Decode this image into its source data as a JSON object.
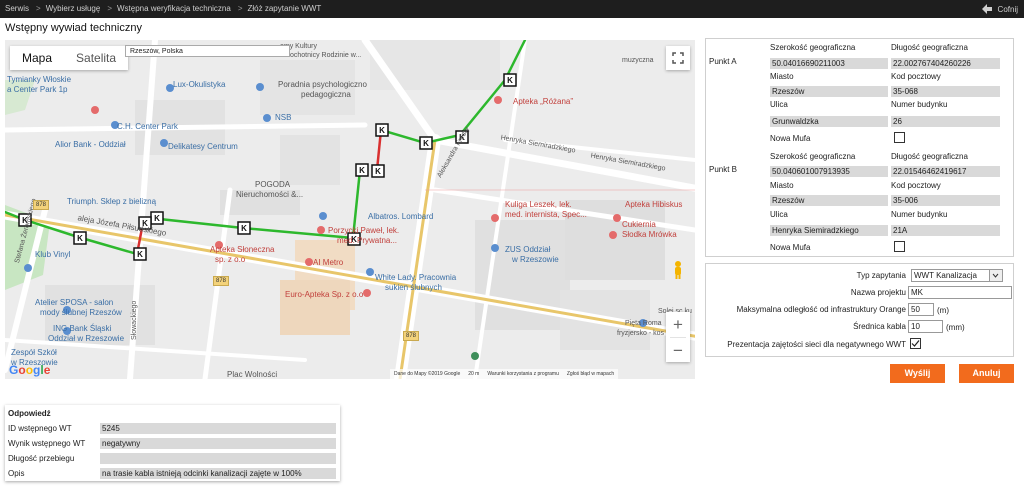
{
  "breadcrumb": [
    "Serwis",
    "Wybierz usługę",
    "Wstępna weryfikacja techniczna",
    "Złóż zapytanie WWT"
  ],
  "back_label": "Cofnij",
  "page_title": "Wstępny wywiad techniczny",
  "map": {
    "tab_map": "Mapa",
    "tab_satellite": "Satelita",
    "search_value": "Rzeszów, Polska",
    "attribution": "Dane do Mapy ©2019 Google",
    "scale": "20 m",
    "terms": "Warunki korzystania z programu",
    "report": "Zgłoś błąd w mapach",
    "google_logo": "Google",
    "cable_marker": "K",
    "labels": {
      "tymianki": "Tymianky Włoskie",
      "center_park_1p": "a Center Park 1p",
      "lux_okulistyka": "Lux-Okulistyka",
      "poradnia": "Poradnia psychologiczno",
      "pedagogiczna": "pedagogiczna",
      "centrum_kultury": "centrum Kultury",
      "domy_kultury": "omy Kultury",
      "ochotnicy": "ochotnicy Rodzinie w...",
      "muzyczna": "muzyczna",
      "ch_center_park": "C.H. Center Park",
      "nsb": "NSB",
      "alior": "Alior Bank - Oddział",
      "delikatesy": "Delikatesy Centrum",
      "apteka_rozana": "Apteka „Różana”",
      "triumph": "Triumph. Sklep z bielizną",
      "pogoda": "POGODA",
      "nieruchomosci": "Nieruchomości &...",
      "henryka1": "Henryka Siemiradzkiego",
      "henryka2": "Henryka Siemiradzkiego",
      "aleksandra": "Aleksandra Fredry",
      "albatros": "Albatros. Lombard",
      "porzycki": "Porzycki Paweł, lek.",
      "porzycki2": "med. Prywatna...",
      "kuliga": "Kuliga Leszek, lek.",
      "kuliga2": "med. internista, Spec...",
      "apteka_hibiskus": "Apteka Hibiskus",
      "cukiernia": "Cukiernia",
      "slodka": "Słodka Mrówka",
      "apteka_sloneczna": "Apteka Słoneczna",
      "apteka_sloneczna2": "sp. z o.o",
      "zus": "ZUS Oddział",
      "zus2": "w Rzeszowie",
      "ai_metro": "AI Metro",
      "white_lady": "White Lady. Pracownia",
      "white_lady2": "sukien ślubnych",
      "euro_apteka": "Euro-Apteka Sp. z o.o",
      "klub_vinyl": "Klub Vinyl",
      "aleja": "aleja Józefa Piłsudskiego",
      "atelier": "Atelier SPOSA - salon",
      "atelier2": "mody ślubnej Rzeszów",
      "ing": "ING Bank Śląski",
      "ing2": "Oddział w Rzeszowie",
      "zespol": "Zespół Szkół",
      "zespol2": "w Rzeszowie",
      "plac": "Plac Wolności",
      "solej": "Solej sc ku",
      "pieta": "Pięta Roma",
      "pieta2": "fryzjersko - kos",
      "stefana": "Stefana Żeromskiego",
      "jana": "Jana Kilińskiego",
      "kolowa": "Słowackiego",
      "plac_wol": "Plac Wolności",
      "rzeszow_p": "w Rzeszów",
      "road_878a": "878",
      "road_878b": "878",
      "road_878c": "878"
    }
  },
  "point_a": {
    "label": "Punkt A",
    "lat_label": "Szerokość geograficzna",
    "lat": "50.04016690211003",
    "lon_label": "Długość geograficzna",
    "lon": "22.002767404260226",
    "city_label": "Miasto",
    "city": "Rzeszów",
    "zip_label": "Kod pocztowy",
    "zip": "35-068",
    "street_label": "Ulica",
    "street": "Grunwaldzka",
    "bldg_label": "Numer budynku",
    "bldg": "26",
    "mufa_label": "Nowa Mufa"
  },
  "point_b": {
    "label": "Punkt B",
    "lat_label": "Szerokość geograficzna",
    "lat": "50.040601007913935",
    "lon_label": "Długość geograficzna",
    "lon": "22.01546462419617",
    "city_label": "Miasto",
    "city": "Rzeszów",
    "zip_label": "Kod pocztowy",
    "zip": "35-006",
    "street_label": "Ulica",
    "street": "Henryka Siemiradzkiego",
    "bldg_label": "Numer budynku",
    "bldg": "21A",
    "mufa_label": "Nowa Mufa"
  },
  "request": {
    "type_label": "Typ zapytania",
    "type_value": "WWT Kanalizacja",
    "project_label": "Nazwa projektu",
    "project_value": "MK",
    "distance_label": "Maksymalna odległość od infrastruktury Orange",
    "distance_value": "50",
    "distance_unit": "(m)",
    "diameter_label": "Średnica kabla",
    "diameter_value": "10",
    "diameter_unit": "(mm)",
    "occupancy_label": "Prezentacja zajętości sieci dla negatywnego WWT"
  },
  "buttons": {
    "send": "Wyślij",
    "cancel": "Anuluj"
  },
  "response": {
    "title": "Odpowiedź",
    "rows": [
      {
        "label": "ID wstępnego WT",
        "value": "5245"
      },
      {
        "label": "Wynik wstępnego WT",
        "value": "negatywny"
      },
      {
        "label": "Długość przebiegu",
        "value": ""
      },
      {
        "label": "Opis",
        "value": "na trasie kabla istnieją odcinki kanalizacji zajęte w 100%"
      }
    ]
  },
  "colors": {
    "accent": "#f26b1d",
    "route_green": "#2db82d",
    "route_red": "#d93030"
  }
}
